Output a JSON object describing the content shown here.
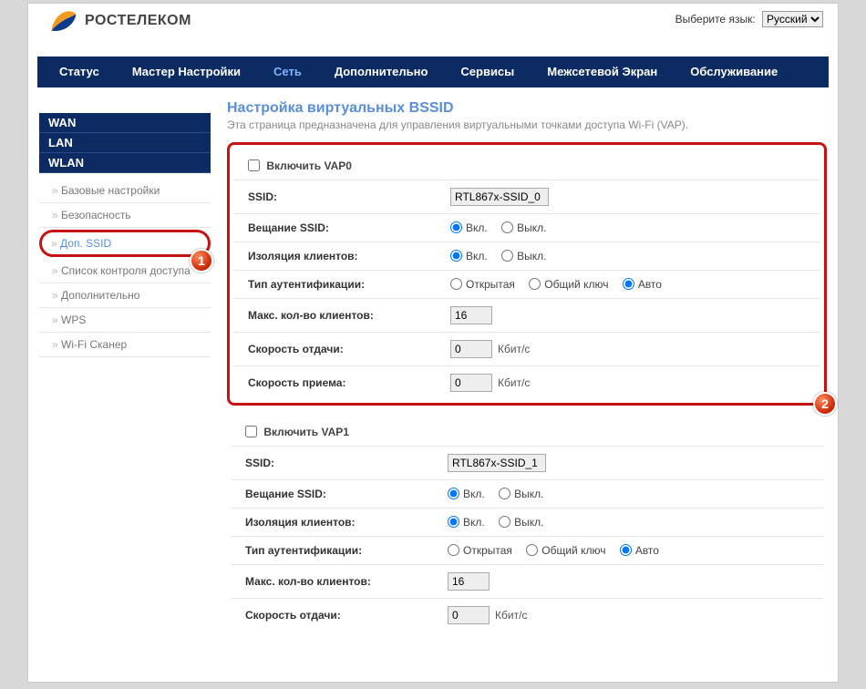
{
  "lang": {
    "label": "Выберите язык:",
    "value": "Русский"
  },
  "brand": "РОСТЕЛЕКОМ",
  "nav": {
    "status": "Статус",
    "wizard": "Мастер Настройки",
    "network": "Сеть",
    "advanced": "Дополнительно",
    "services": "Сервисы",
    "firewall": "Межсетевой Экран",
    "maintenance": "Обслуживание"
  },
  "side_major": {
    "wan": "WAN",
    "lan": "LAN",
    "wlan": "WLAN"
  },
  "side_sub": {
    "basic": "Базовые настройки",
    "security": "Безопасность",
    "add_ssid": "Доп. SSID",
    "acl": "Список контроля доступа",
    "advanced": "Дополнительно",
    "wps": "WPS",
    "scanner": "Wi-Fi Сканер"
  },
  "page": {
    "title": "Настройка виртуальных BSSID",
    "desc": "Эта страница предназначена для управления виртуальными точками доступа Wi-Fi (VAP)."
  },
  "labels": {
    "enable_vap0": "Включить VAP0",
    "enable_vap1": "Включить VAP1",
    "ssid": "SSID:",
    "broadcast": "Вещание SSID:",
    "isolation": "Изоляция клиентов:",
    "auth": "Тип аутентификации:",
    "max_clients": "Макс. кол-во клиентов:",
    "tx_rate": "Скорость отдачи:",
    "rx_rate": "Скорость приема:",
    "on": "Вкл.",
    "off": "Выкл.",
    "open": "Открытая",
    "shared": "Общий ключ",
    "auto": "Авто",
    "unit_kbps": "Кбит/с"
  },
  "vap0": {
    "ssid": "RTL867x-SSID_0",
    "max_clients": "16",
    "tx": "0",
    "rx": "0"
  },
  "vap1": {
    "ssid": "RTL867x-SSID_1",
    "max_clients": "16",
    "tx": "0"
  },
  "badges": {
    "one": "1",
    "two": "2"
  }
}
